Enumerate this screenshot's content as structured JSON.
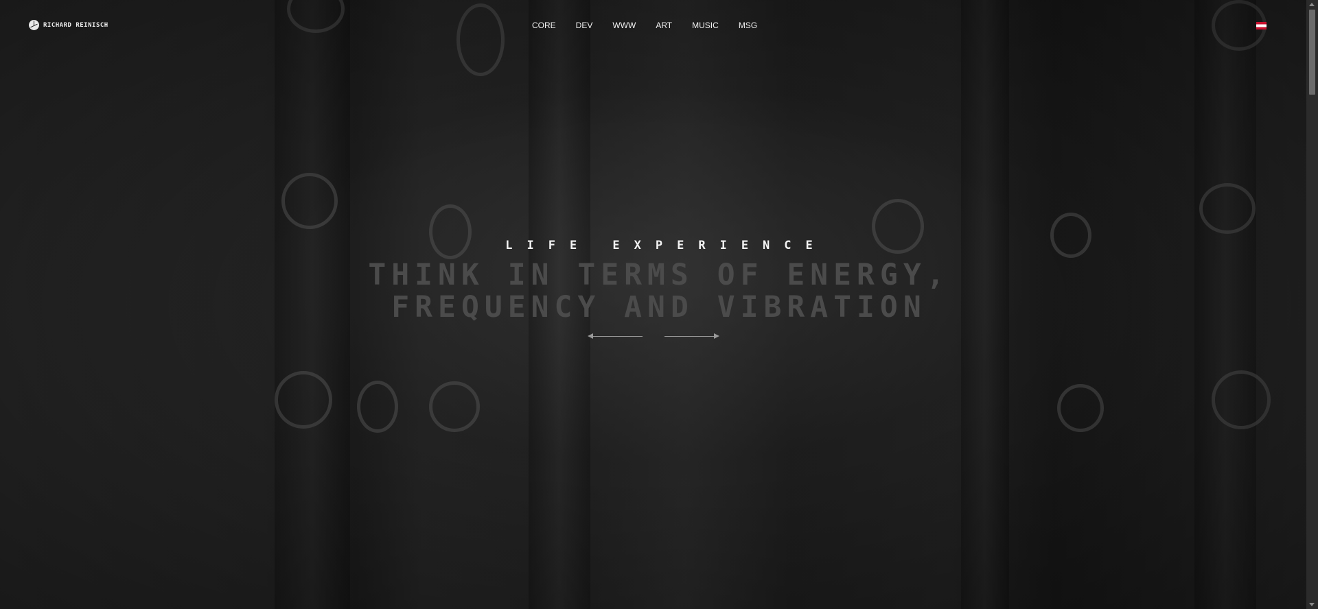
{
  "header": {
    "logo_text": "RICHARD REINISCH",
    "logo_icon": "globe-logo-icon",
    "nav": [
      {
        "label": "CORE"
      },
      {
        "label": "DEV"
      },
      {
        "label": "WWW"
      },
      {
        "label": "ART"
      },
      {
        "label": "MUSIC"
      },
      {
        "label": "MSG"
      }
    ],
    "language_flag": "austria-flag-icon"
  },
  "hero": {
    "subtitle": "LIFE EXPERIENCE",
    "headline_line1": "THINK IN TERMS OF ENERGY,",
    "headline_line2": "FREQUENCY AND VIBRATION",
    "prev_icon": "arrow-left-icon",
    "next_icon": "arrow-right-icon"
  },
  "colors": {
    "background": "#1b1b1b",
    "subtitle": "#f3f3f3",
    "headline": "#4b4b4b",
    "flag_red": "#c8102e"
  }
}
